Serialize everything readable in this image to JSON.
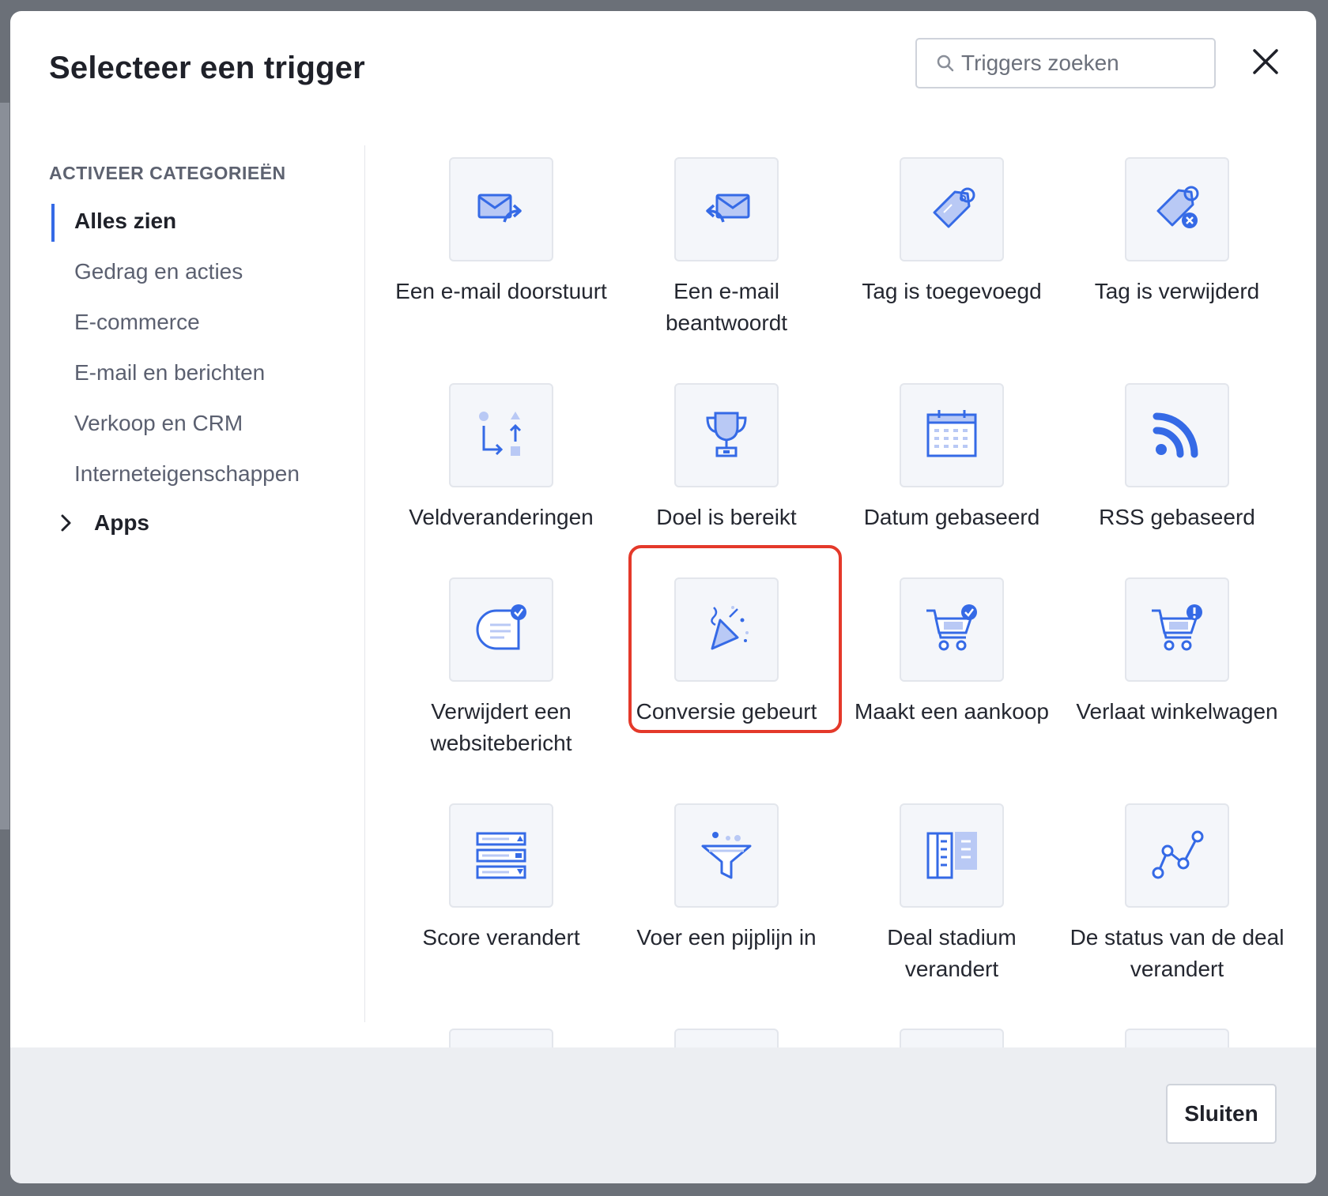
{
  "modal": {
    "title": "Selecteer een trigger",
    "search_placeholder": "Triggers zoeken",
    "close_label": "Sluiten"
  },
  "sidebar": {
    "heading": "ACTIVEER CATEGORIEËN",
    "active_item": "Alles zien",
    "items": [
      "Alles zien",
      "Gedrag en acties",
      "E-commerce",
      "E-mail en berichten",
      "Verkoop en CRM",
      "Interneteigenschappen"
    ],
    "apps_label": "Apps"
  },
  "triggers": [
    {
      "label": "Een e-mail doorstuurt",
      "icon": "email-forward-icon"
    },
    {
      "label": "Een e-mail beantwoordt",
      "icon": "email-reply-icon"
    },
    {
      "label": "Tag is toegevoegd",
      "icon": "tag-added-icon"
    },
    {
      "label": "Tag is verwijderd",
      "icon": "tag-removed-icon"
    },
    {
      "label": "Veldveranderingen",
      "icon": "field-change-icon"
    },
    {
      "label": "Doel is bereikt",
      "icon": "trophy-icon"
    },
    {
      "label": "Datum gebaseerd",
      "icon": "calendar-icon"
    },
    {
      "label": "RSS gebaseerd",
      "icon": "rss-icon"
    },
    {
      "label": "Verwijdert een websitebericht",
      "icon": "site-message-icon"
    },
    {
      "label": "Conversie gebeurt",
      "icon": "party-popper-icon",
      "highlighted": true
    },
    {
      "label": "Maakt een aankoop",
      "icon": "cart-check-icon"
    },
    {
      "label": "Verlaat winkelwagen",
      "icon": "cart-alert-icon"
    },
    {
      "label": "Score verandert",
      "icon": "score-list-icon"
    },
    {
      "label": "Voer een pijplijn in",
      "icon": "funnel-icon"
    },
    {
      "label": "Deal stadium verandert",
      "icon": "deal-stage-icon"
    },
    {
      "label": "De status van de deal verandert",
      "icon": "deal-status-chart-icon"
    }
  ],
  "colors": {
    "accent": "#356ae6",
    "highlight": "#e4392a",
    "icon_light": "#b9c9f5"
  }
}
